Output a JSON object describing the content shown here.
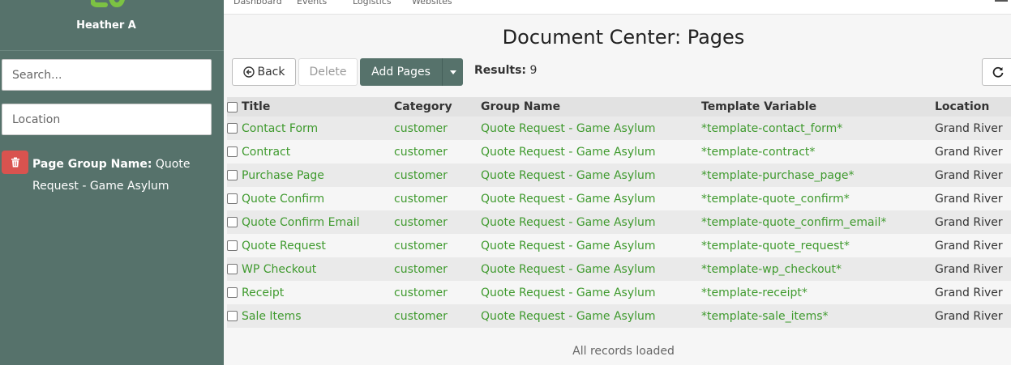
{
  "app": {
    "user_name": "Heather A"
  },
  "nav": {
    "items": [
      "Dashboard",
      "Events",
      "Logistics",
      "Websites"
    ]
  },
  "sidebar": {
    "search_placeholder": "Search...",
    "location_placeholder": "Location",
    "filter_key": "Page Group Name:",
    "filter_value": "Quote Request - Game Asylum"
  },
  "page": {
    "title": "Document Center: Pages"
  },
  "toolbar": {
    "back_label": "Back",
    "delete_label": "Delete",
    "add_label": "Add Pages",
    "results_label": "Results:",
    "results_count": "9"
  },
  "table": {
    "headers": [
      "Title",
      "Category",
      "Group Name",
      "Template Variable",
      "Location"
    ],
    "rows": [
      {
        "title": "Contact Form",
        "category": "customer",
        "group": "Quote Request - Game Asylum",
        "template": "*template-contact_form*",
        "location": "Grand River"
      },
      {
        "title": "Contract",
        "category": "customer",
        "group": "Quote Request - Game Asylum",
        "template": "*template-contract*",
        "location": "Grand River"
      },
      {
        "title": "Purchase Page",
        "category": "customer",
        "group": "Quote Request - Game Asylum",
        "template": "*template-purchase_page*",
        "location": "Grand River"
      },
      {
        "title": "Quote Confirm",
        "category": "customer",
        "group": "Quote Request - Game Asylum",
        "template": "*template-quote_confirm*",
        "location": "Grand River"
      },
      {
        "title": "Quote Confirm Email",
        "category": "customer",
        "group": "Quote Request - Game Asylum",
        "template": "*template-quote_confirm_email*",
        "location": "Grand River"
      },
      {
        "title": "Quote Request",
        "category": "customer",
        "group": "Quote Request - Game Asylum",
        "template": "*template-quote_request*",
        "location": "Grand River"
      },
      {
        "title": "WP Checkout",
        "category": "customer",
        "group": "Quote Request - Game Asylum",
        "template": "*template-wp_checkout*",
        "location": "Grand River"
      },
      {
        "title": "Receipt",
        "category": "customer",
        "group": "Quote Request - Game Asylum",
        "template": "*template-receipt*",
        "location": "Grand River"
      },
      {
        "title": "Sale Items",
        "category": "customer",
        "group": "Quote Request - Game Asylum",
        "template": "*template-sale_items*",
        "location": "Grand River"
      }
    ],
    "footer_note": "All records loaded"
  },
  "colors": {
    "sidebar_bg": "#56726b",
    "accent": "#56726b",
    "link_green": "#3f9a2e",
    "danger": "#d9534f",
    "logo_green": "#7cc243"
  }
}
